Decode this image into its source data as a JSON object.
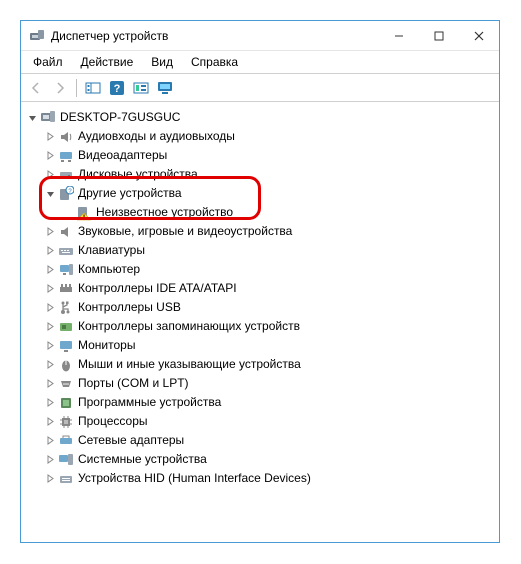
{
  "window": {
    "title": "Диспетчер устройств"
  },
  "menubar": {
    "file": "Файл",
    "action": "Действие",
    "view": "Вид",
    "help": "Справка"
  },
  "tree": {
    "root": "DESKTOP-7GUSGUC",
    "nodes": {
      "audio": "Аудиовходы и аудиовыходы",
      "video": "Видеоадаптеры",
      "disk": "Дисковые устройства",
      "other": "Другие устройства",
      "unknown": "Неизвестное устройство",
      "sound": "Звуковые, игровые и видеоустройства",
      "keyboard": "Клавиатуры",
      "computer": "Компьютер",
      "ide": "Контроллеры IDE ATA/ATAPI",
      "usb": "Контроллеры USB",
      "storage": "Контроллеры запоминающих устройств",
      "monitor": "Мониторы",
      "mouse": "Мыши и иные указывающие устройства",
      "ports": "Порты (COM и LPT)",
      "software": "Программные устройства",
      "cpu": "Процессоры",
      "net": "Сетевые адаптеры",
      "system": "Системные устройства",
      "hid": "Устройства HID (Human Interface Devices)"
    }
  }
}
